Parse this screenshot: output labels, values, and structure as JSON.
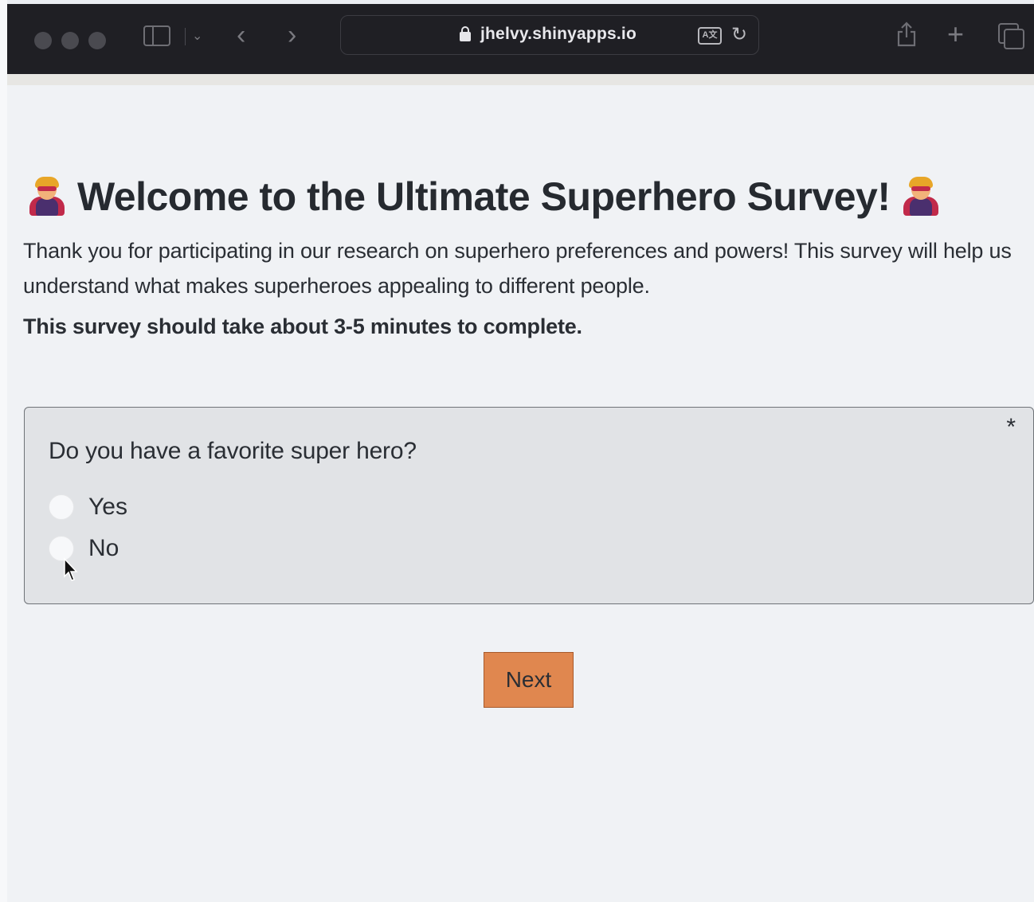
{
  "browser": {
    "url": "jhelvy.shinyapps.io"
  },
  "page": {
    "title": "Welcome to the Ultimate Superhero Survey!",
    "intro": "Thank you for participating in our research on superhero preferences and powers! This survey will help us understand what makes superheroes appealing to different people.",
    "time_note": "This survey should take about 3-5 minutes to complete."
  },
  "question": {
    "required_mark": "*",
    "text": "Do you have a favorite super hero?",
    "options": [
      {
        "label": "Yes"
      },
      {
        "label": "No"
      }
    ]
  },
  "actions": {
    "next_label": "Next"
  },
  "colors": {
    "toolbar": "#1f1f24",
    "page_background": "#f0f2f5",
    "card_background": "#e1e3e6",
    "next_button": "#e0874f"
  }
}
